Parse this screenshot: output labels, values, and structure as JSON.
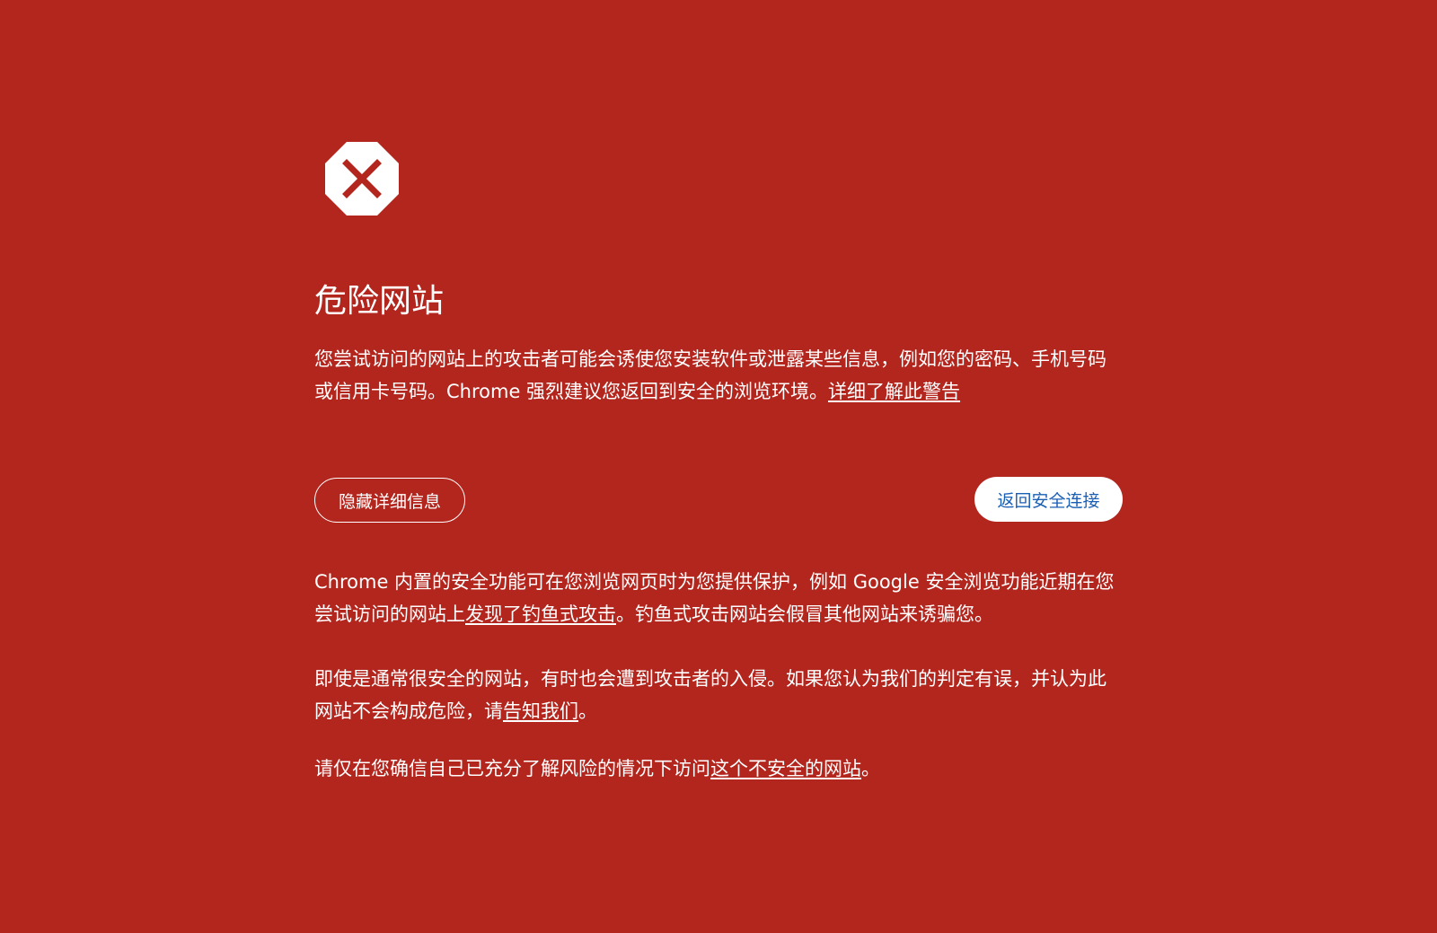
{
  "page": {
    "background_color": "#b3261e",
    "icon": "stop-sign-icon"
  },
  "heading": {
    "title": "危险网站"
  },
  "intro": {
    "text": "您尝试访问的网站上的攻击者可能会诱使您安装软件或泄露某些信息，例如您的密码、手机号码或信用卡号码。Chrome 强烈建议您返回到安全的浏览环境。",
    "learn_more_link": "详细了解此警告"
  },
  "buttons": {
    "hide_details_label": "隐藏详细信息",
    "back_to_safety_label": "返回安全连接",
    "back_to_safety_text_color": "#1a5fb4"
  },
  "details": {
    "para1_before": "Chrome 内置的安全功能可在您浏览网页时为您提供保护，例如 Google 安全浏览功能近期在您尝试访问的网站上",
    "para1_link": "发现了钓鱼式攻击",
    "para1_after": "。钓鱼式攻击网站会假冒其他网站来诱骗您。",
    "para2_before": "即使是通常很安全的网站，有时也会遭到攻击者的入侵。如果您认为我们的判定有误，并认为此网站不会构成危险，请",
    "para2_link": "告知我们",
    "para2_after": "。",
    "para3_before": "请仅在您确信自己已充分了解风险的情况下访问",
    "para3_link": "这个不安全的网站",
    "para3_after": "。"
  }
}
